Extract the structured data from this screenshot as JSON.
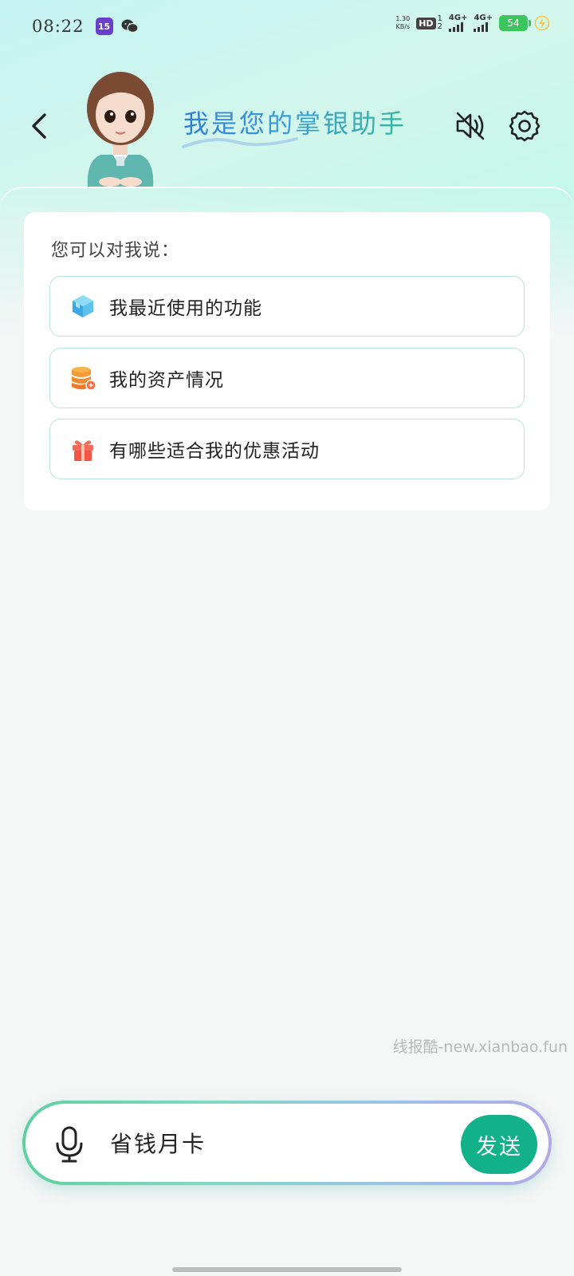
{
  "status_bar": {
    "time": "08:22",
    "app_badge": "15",
    "net_speed_value": "1.30",
    "net_speed_unit": "KB/s",
    "hd_label": "HD",
    "hd_nums_top": "1",
    "hd_nums_bottom": "2",
    "signal1_label": "4G+",
    "signal2_label": "4G+",
    "battery": "54"
  },
  "header": {
    "title": "我是您的掌银助手",
    "icons": [
      "chevron-left-icon",
      "avatar-assistant",
      "speaker-muted-icon",
      "gear-icon"
    ]
  },
  "suggestions": {
    "heading": "您可以对我说：",
    "items": [
      {
        "label": "我最近使用的功能",
        "icon": "cube-icon"
      },
      {
        "label": "我的资产情况",
        "icon": "database-coin-icon"
      },
      {
        "label": "有哪些适合我的优惠活动",
        "icon": "gift-icon"
      }
    ]
  },
  "watermark": "线报酷-new.xianbao.fun",
  "input_bar": {
    "value": "省钱月卡",
    "send_label": "发送"
  },
  "colors": {
    "accent": "#12b18a",
    "title_start": "#2f7fd6",
    "title_end": "#35b79c",
    "card_border": "#b8e2dc"
  }
}
